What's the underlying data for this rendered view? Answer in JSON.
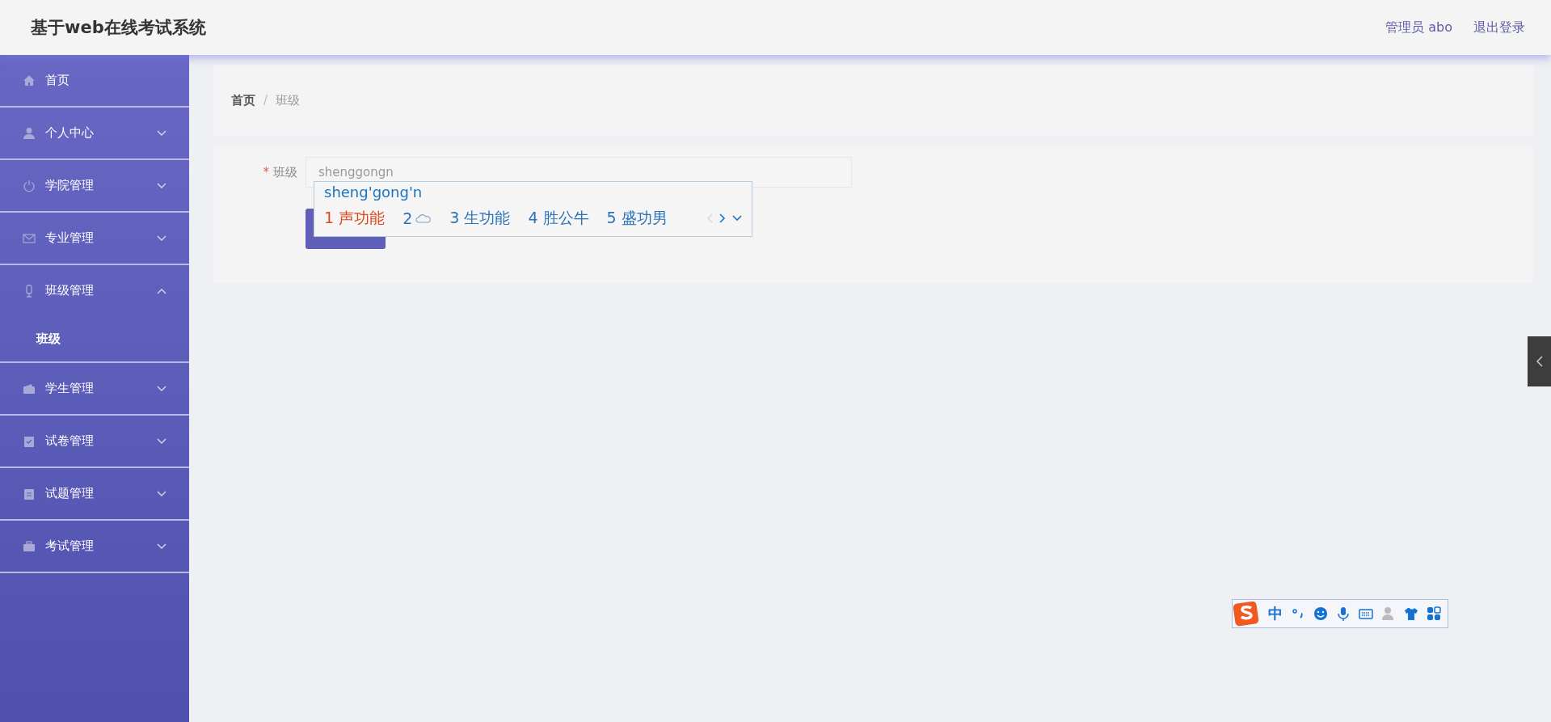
{
  "header": {
    "title": "基于web在线考试系统",
    "user": "管理员 abo",
    "logout": "退出登录"
  },
  "sidebar": {
    "items": [
      {
        "label": "首页"
      },
      {
        "label": "个人中心",
        "expanded": false
      },
      {
        "label": "学院管理",
        "expanded": false
      },
      {
        "label": "专业管理",
        "expanded": false
      },
      {
        "label": "班级管理",
        "expanded": true,
        "children": [
          {
            "label": "班级"
          }
        ]
      },
      {
        "label": "学生管理",
        "expanded": false
      },
      {
        "label": "试卷管理",
        "expanded": false
      },
      {
        "label": "试题管理",
        "expanded": false
      },
      {
        "label": "考试管理",
        "expanded": false
      }
    ]
  },
  "breadcrumb": {
    "separator": "/",
    "items": [
      "首页",
      "班级"
    ]
  },
  "form": {
    "fields": [
      {
        "label": "班级",
        "required_mark": "*",
        "value": "shenggongn"
      }
    ],
    "submit_button": {
      "kind": "primary"
    }
  },
  "ime_popup": {
    "composition": "sheng'gong'n",
    "candidates": [
      {
        "index": "1",
        "text": "声功能",
        "kind": "text",
        "selected": true
      },
      {
        "index": "2",
        "kind": "cloud",
        "selected": false
      },
      {
        "index": "3",
        "text": "生功能",
        "kind": "text",
        "selected": false
      },
      {
        "index": "4",
        "text": "胜公牛",
        "kind": "text",
        "selected": false
      },
      {
        "index": "5",
        "text": "盛功男",
        "kind": "text",
        "selected": false
      }
    ]
  },
  "ime_toolbar": {
    "mode": "中"
  }
}
